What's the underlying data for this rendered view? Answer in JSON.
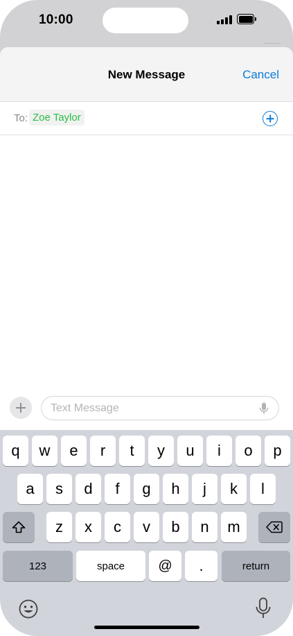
{
  "status_bar": {
    "time": "10:00",
    "icons": [
      "signal-icon",
      "battery-icon"
    ]
  },
  "nav": {
    "title": "New Message",
    "cancel_label": "Cancel"
  },
  "recipient": {
    "to_label": "To:",
    "name": "Zoe Taylor",
    "add_icon": "add-contact-icon"
  },
  "composer": {
    "apps_icon": "plus-icon",
    "placeholder": "Text Message",
    "mic_icon": "microphone-icon"
  },
  "keyboard": {
    "row1": [
      "q",
      "w",
      "e",
      "r",
      "t",
      "y",
      "u",
      "i",
      "o",
      "p"
    ],
    "row2": [
      "a",
      "s",
      "d",
      "f",
      "g",
      "h",
      "j",
      "k",
      "l"
    ],
    "row3": [
      "z",
      "x",
      "c",
      "v",
      "b",
      "n",
      "m"
    ],
    "numbers_label": "123",
    "space_label": "space",
    "at_label": "@",
    "period_label": ".",
    "return_label": "return",
    "shift_icon": "shift-icon",
    "delete_icon": "delete-icon",
    "emoji_icon": "emoji-icon",
    "dictation_icon": "microphone-icon"
  },
  "colors": {
    "accent": "#0a7bd8",
    "recipient_green": "#2dbb4a",
    "keyboard_bg": "#d1d4da"
  }
}
